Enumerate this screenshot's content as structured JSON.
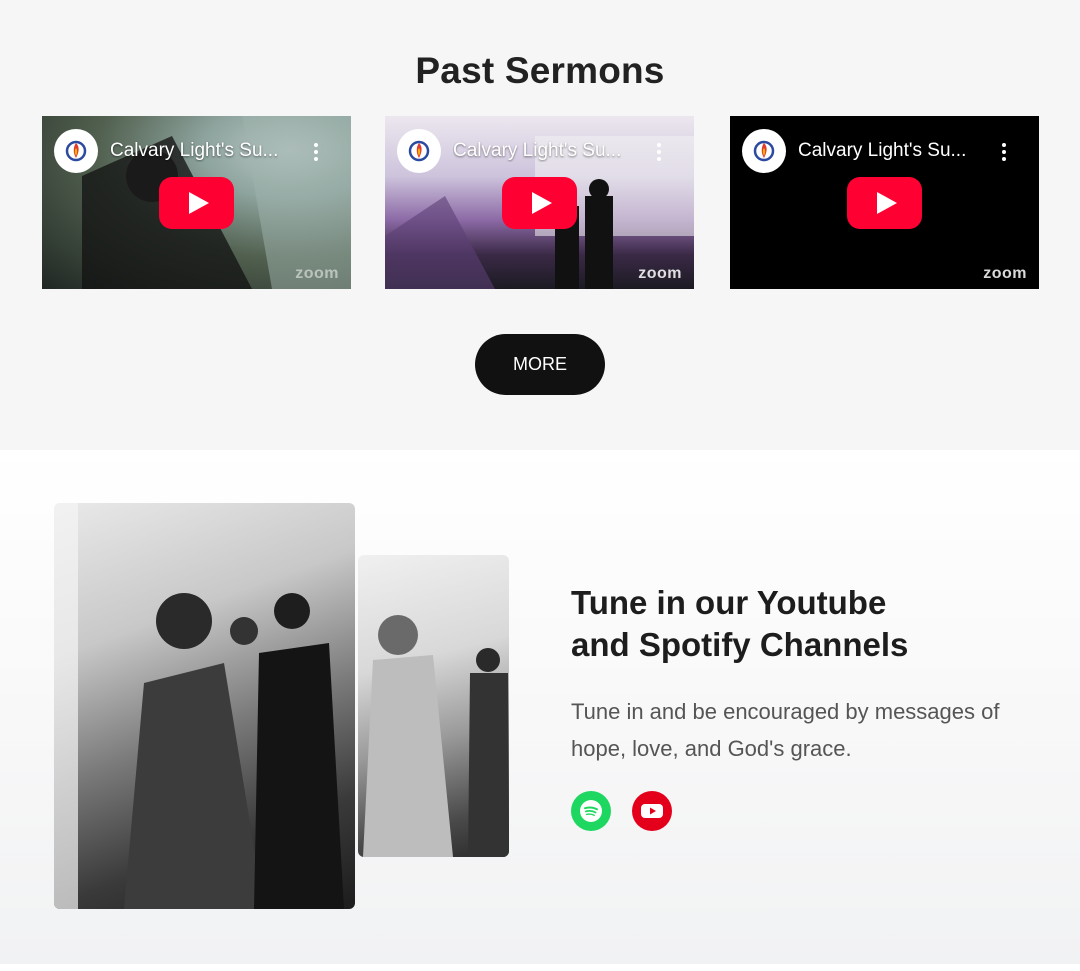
{
  "sermons": {
    "title": "Past Sermons",
    "videos": [
      {
        "title": "Calvary Light's Su...",
        "watermark": "zoom",
        "caption": "Calvary Light"
      },
      {
        "title": "Calvary Light's Su...",
        "watermark": "zoom",
        "caption": "Calvary Light"
      },
      {
        "title": "Calvary Light's Su...",
        "watermark": "zoom"
      }
    ],
    "more_label": "MORE"
  },
  "tune": {
    "heading_line1": "Tune in our Youtube",
    "heading_line2": "and Spotify Channels",
    "description": "Tune in and be encouraged by messages of hope, love, and God's grace.",
    "icons": [
      "spotify-icon",
      "youtube-icon"
    ]
  },
  "colors": {
    "play_red": "#ff0033",
    "spotify_green": "#1ed760",
    "youtube_red": "#e4001b",
    "button_bg": "#111111"
  }
}
